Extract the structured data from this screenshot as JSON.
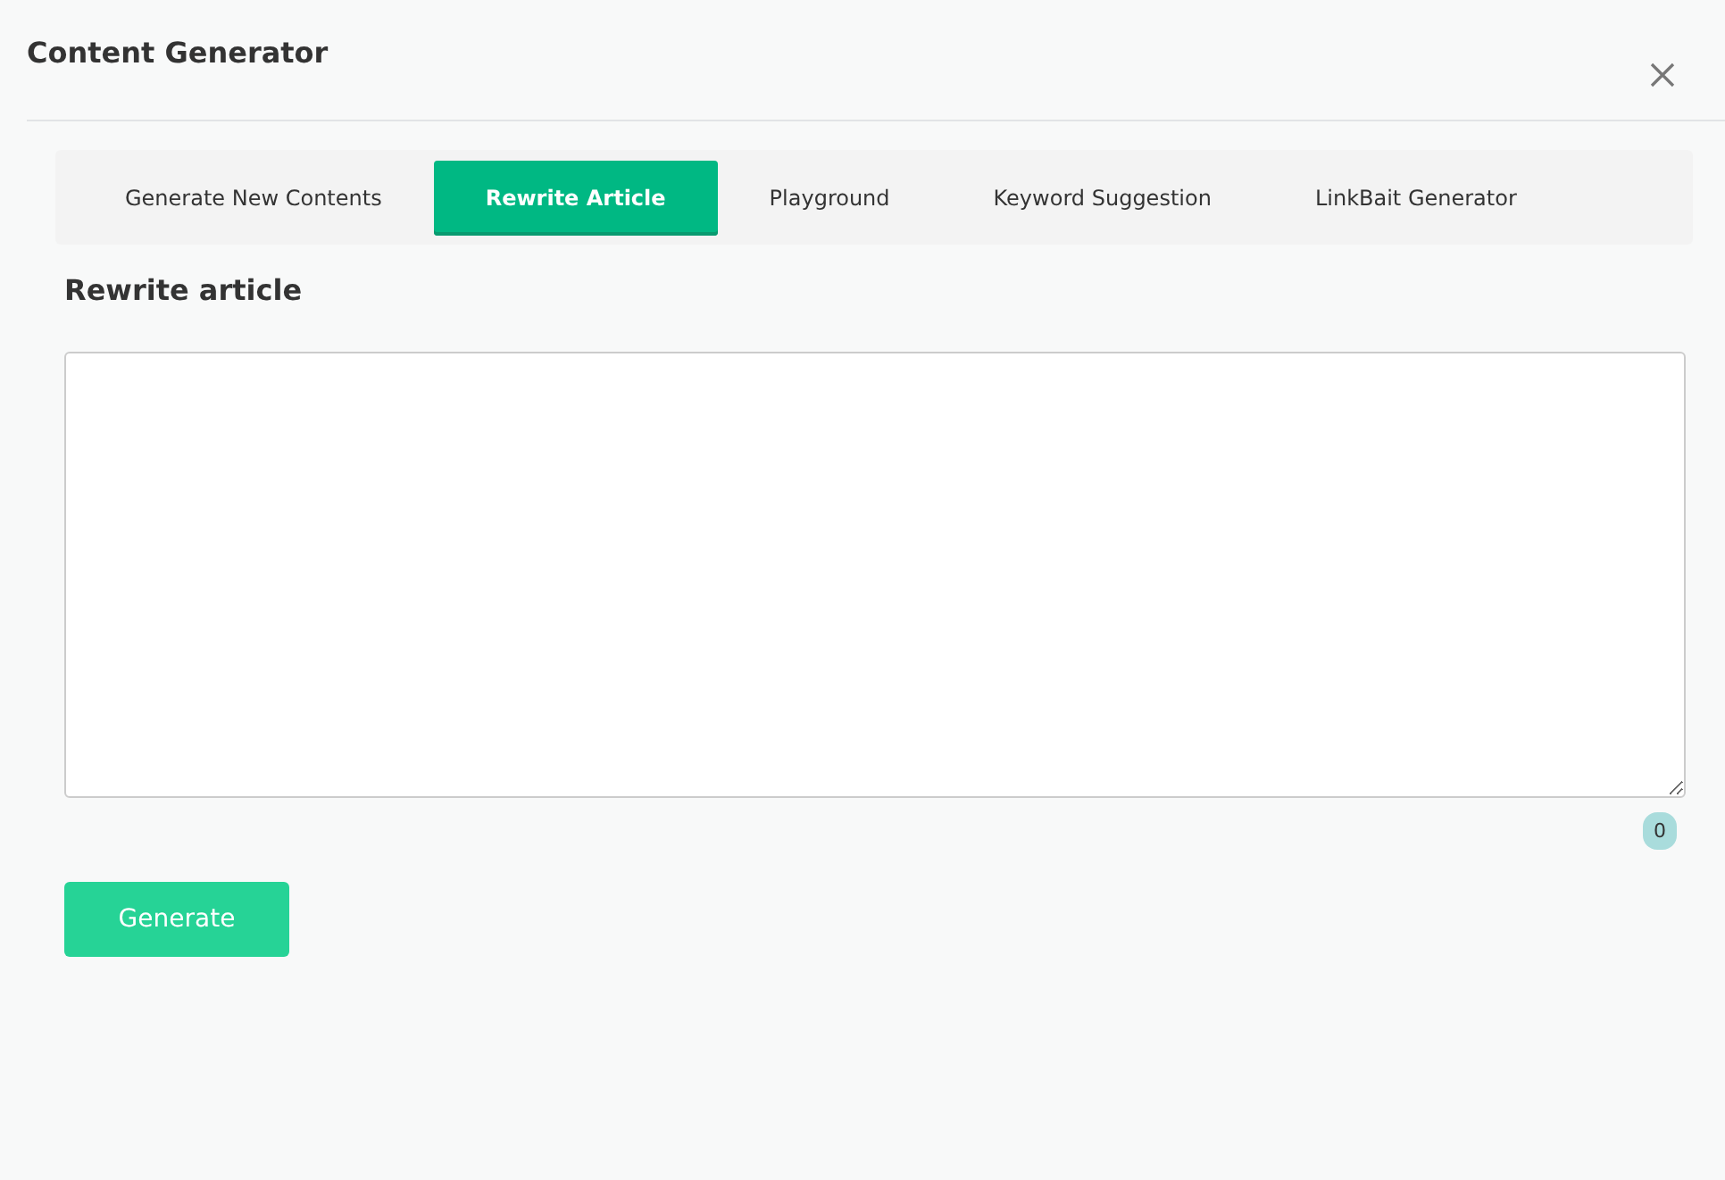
{
  "window": {
    "title": "Content Generator"
  },
  "tabs": [
    {
      "label": "Generate New Contents",
      "selected": false
    },
    {
      "label": "Rewrite Article",
      "selected": true
    },
    {
      "label": "Playground",
      "selected": false
    },
    {
      "label": "Keyword Suggestion",
      "selected": false
    },
    {
      "label": "LinkBait Generator",
      "selected": false
    }
  ],
  "section": {
    "heading": "Rewrite article",
    "char_count": "0"
  },
  "buttons": [
    "Generate"
  ]
}
